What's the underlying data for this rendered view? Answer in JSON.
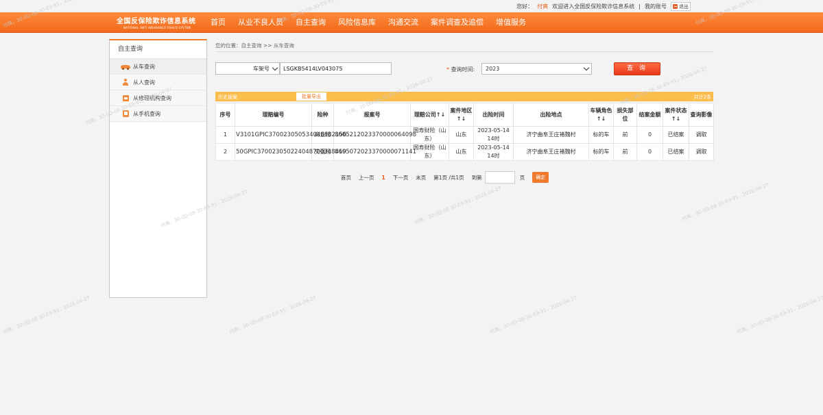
{
  "topbar": {
    "greeting": "您好：",
    "username": "付爽",
    "welcome": "欢迎进入全国反保险欺诈信息系统",
    "separator": "|",
    "my_account": "我的账号",
    "logout": "退出"
  },
  "logo": {
    "title_cn": "全国反保险欺诈信息系统",
    "title_en": "NATIONAL ANTI INSURANCE FRAUD SYSTEM"
  },
  "nav": [
    "首页",
    "从业不良人员",
    "自主查询",
    "风险信息库",
    "沟通交流",
    "案件调查及追偿",
    "增值服务"
  ],
  "sidebar": {
    "title": "自主查询",
    "items": [
      {
        "label": "从车查询",
        "icon": "car-icon"
      },
      {
        "label": "从人查询",
        "icon": "person-icon"
      },
      {
        "label": "从修理机构查询",
        "icon": "shop-icon"
      },
      {
        "label": "从手机查询",
        "icon": "phone-icon"
      }
    ]
  },
  "breadcrumb": "您的位置：自主查询 >> 从车查询",
  "search": {
    "field_type": "车架号",
    "vin_value": "LSGKB5414LV043075",
    "time_required": "*",
    "time_label": "查询时间:",
    "year": "2023",
    "query_button": "查 询"
  },
  "results_bar": {
    "history_label": "历史报案",
    "export_button": "批量导出",
    "total": "共计2条"
  },
  "table": {
    "headers": [
      "序号",
      "理赔编号",
      "险种",
      "报案号",
      "理赔公司↑↓",
      "案件地区↑↓",
      "出险时间",
      "出险地点",
      "车辆角色↑↓",
      "损失部位",
      "结案金额",
      "案件状态↑↓",
      "查询影像"
    ],
    "rows": [
      [
        "1",
        "V3101GPIC370023050534048882156",
        "商业险",
        "8605212023370000064098",
        "国寿财险（山东）",
        "山东",
        "2023-05-14 14时",
        "济宁曲阜王庄褚魏村",
        "标的车",
        "前",
        "0",
        "已结案",
        "调取"
      ],
      [
        "2",
        "50GPIC370023050224048700348419",
        "交强险",
        "8605072023370000071141",
        "国寿财险（山东）",
        "山东",
        "2023-05-14 14时",
        "济宁曲阜王庄褚魏村",
        "标的车",
        "前",
        "0",
        "已结案",
        "调取"
      ]
    ]
  },
  "pager": {
    "first": "首页",
    "prev": "上一页",
    "current": "1",
    "next": "下一页",
    "last": "末页",
    "info": "第1页 /共1页",
    "goto_label": "到第",
    "page_suffix": "页",
    "confirm": "确定"
  },
  "watermark": "付爽，30-0D-08-30-E9-91，2026-04-27",
  "colors": {
    "header_orange": "#f26a1b",
    "results_bar": "#fbbd4c",
    "query_button": "#e83a18"
  }
}
